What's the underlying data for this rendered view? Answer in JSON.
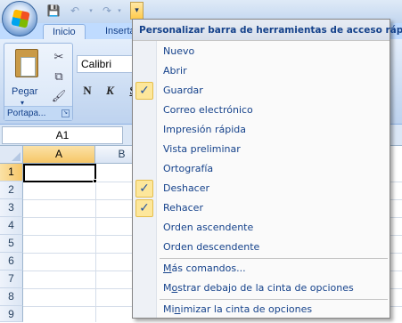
{
  "ribbon": {
    "tabs": [
      {
        "label": "Inicio",
        "active": true
      },
      {
        "label": "Inserta"
      }
    ],
    "clipboard_group": {
      "paste_label": "Pegar",
      "paste_arrow": "▾",
      "group_label": "Portapa...",
      "launcher_glyph": "↘"
    },
    "font": {
      "font_name": "Calibri",
      "bold": "N",
      "italic": "K",
      "underline": "S"
    }
  },
  "qat": {
    "save_glyph": "💾",
    "undo_glyph": "↶",
    "redo_glyph": "↷",
    "customize_glyph": "▾"
  },
  "name_box": {
    "value": "A1"
  },
  "grid": {
    "columns": [
      "A",
      "B"
    ],
    "rows": [
      "1",
      "2",
      "3",
      "4",
      "5",
      "6",
      "7",
      "8",
      "9"
    ],
    "active_cell": "A1"
  },
  "qat_menu": {
    "title": "Personalizar barra de herramientas de acceso rápido",
    "check_glyph": "✓",
    "items": [
      {
        "label": "Nuevo",
        "checked": false
      },
      {
        "label": "Abrir",
        "checked": false
      },
      {
        "label": "Guardar",
        "checked": true
      },
      {
        "label": "Correo electrónico",
        "checked": false
      },
      {
        "label": "Impresión rápida",
        "checked": false
      },
      {
        "label": "Vista preliminar",
        "checked": false
      },
      {
        "label": "Ortografía",
        "checked": false
      },
      {
        "label": "Deshacer",
        "checked": true
      },
      {
        "label": "Rehacer",
        "checked": true
      },
      {
        "label": "Orden ascendente",
        "checked": false
      },
      {
        "label": "Orden descendente",
        "checked": false
      }
    ],
    "more_commands": {
      "underlined": "M",
      "rest": "ás comandos..."
    },
    "show_below": {
      "prefix": "M",
      "underlined": "o",
      "rest": "strar debajo de la cinta de opciones"
    },
    "minimize": {
      "prefix": "Mi",
      "underlined": "n",
      "rest": "imizar la cinta de opciones"
    }
  }
}
